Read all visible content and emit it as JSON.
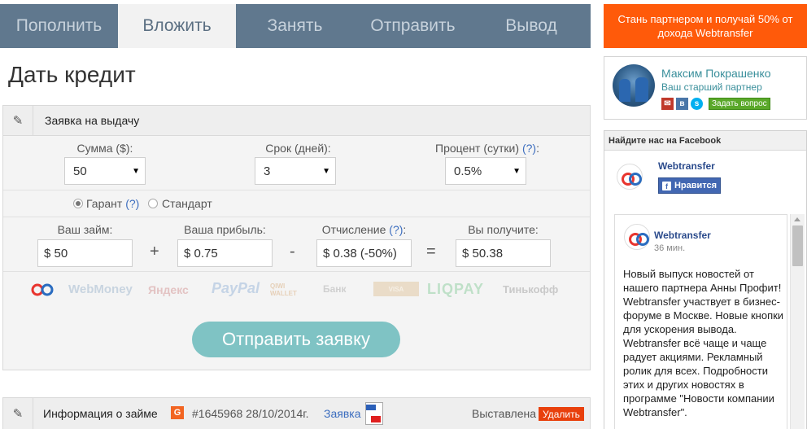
{
  "nav": {
    "tabs": [
      {
        "label": "Пополнить"
      },
      {
        "label": "Вложить"
      },
      {
        "label": "Занять"
      },
      {
        "label": "Отправить"
      },
      {
        "label": "Вывод"
      }
    ],
    "active_tab": "Вложить"
  },
  "partner_banner": "Стань партнером и получай 50% от дохода Webtransfer",
  "page_title": "Дать кредит",
  "form": {
    "title": "Заявка на выдачу",
    "amount_label": "Сумма ($):",
    "amount_value": "50",
    "term_label": "Срок (дней):",
    "term_value": "3",
    "percent_label": "Процент (сутки)",
    "percent_help": "(?)",
    "percent_colon": ":",
    "percent_value": "0.5%",
    "guarantee_label": "Гарант",
    "guarantee_help": "(?)",
    "standard_label": "Стандарт",
    "guarantee_selected": true,
    "your_loan_label": "Ваш займ:",
    "your_loan_value": "$ 50",
    "profit_label": "Ваша прибыль:",
    "profit_value": "$ 0.75",
    "fee_label": "Отчисление",
    "fee_help": "(?)",
    "fee_colon": ":",
    "fee_value": "$ 0.38 (-50%)",
    "receive_label": "Вы получите:",
    "receive_value": "$ 50.38",
    "op_plus": "+",
    "op_minus": "-",
    "op_equals": "=",
    "payment_methods": [
      "WebMoney",
      "Яндекс",
      "PayPal",
      "QIWI WALLET",
      "Банк",
      "VISA",
      "LIQPAY",
      "Тинькофф"
    ],
    "submit_label": "Отправить заявку"
  },
  "loan_info": {
    "title": "Информация о займе",
    "badge": "G",
    "number": "#1645968 28/10/2014г.",
    "link": "Заявка",
    "status": "Выставлена",
    "delete_label": "Удалить"
  },
  "partner": {
    "name": "Максим Покрашенко",
    "role": "Ваш старший партнер",
    "ask_label": "Задать вопрос"
  },
  "facebook": {
    "header": "Найдите нас на Facebook",
    "page_name": "Webtransfer",
    "like_label": "Нравится",
    "like_icon_glyph": "f",
    "post": {
      "author": "Webtransfer",
      "time": "36 мин.",
      "text": "Новый выпуск новостей от нашего партнера Анны Профит! Webtransfer участвует в бизнес-форуме в Москве. Новые кнопки для ускорения вывода. Webtransfer всё чаще и чаще радует акциями. Рекламный ролик для всех. Подробности этих и других новостях в программе \"Новости компании Webtransfer\"."
    }
  },
  "colors": {
    "nav_bg": "#60788e",
    "banner_bg": "#ff5a0a",
    "submit_bg": "#7fc3c4",
    "delete_bg": "#e8400c"
  }
}
